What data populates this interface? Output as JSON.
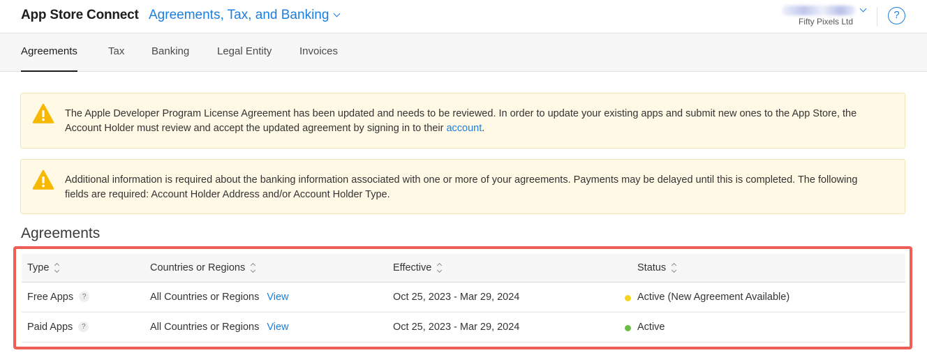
{
  "header": {
    "brand": "App Store Connect",
    "section_menu_label": "Agreements, Tax, and Banking",
    "account_org": "Fifty Pixels Ltd",
    "help_label": "?"
  },
  "tabs": [
    {
      "label": "Agreements",
      "active": true
    },
    {
      "label": "Tax",
      "active": false
    },
    {
      "label": "Banking",
      "active": false
    },
    {
      "label": "Legal Entity",
      "active": false
    },
    {
      "label": "Invoices",
      "active": false
    }
  ],
  "alerts": [
    {
      "icon": "warning-icon",
      "text_before_link": "The Apple Developer Program License Agreement has been updated and needs to be reviewed. In order to update your existing apps and submit new ones to the App Store, the Account Holder must review and accept the updated agreement by signing in to their ",
      "link_text": "account",
      "text_after_link": "."
    },
    {
      "icon": "warning-icon",
      "text": "Additional information is required about the banking information associated with one or more of your agreements. Payments may be delayed until this is completed. The following fields are required: Account Holder Address and/or Account Holder Type."
    }
  ],
  "agreements": {
    "title": "Agreements",
    "columns": [
      "Type",
      "Countries or Regions",
      "Effective",
      "Status"
    ],
    "rows": [
      {
        "type": "Free Apps",
        "help": "?",
        "regions": "All Countries or Regions",
        "view_label": "View",
        "effective": "Oct 25, 2023 - Mar 29, 2024",
        "status": "Active (New Agreement Available)",
        "status_color": "#f5d41f"
      },
      {
        "type": "Paid Apps",
        "help": "?",
        "regions": "All Countries or Regions",
        "view_label": "View",
        "effective": "Oct 25, 2023 - Mar 29, 2024",
        "status": "Active",
        "status_color": "#6cbd45"
      }
    ]
  },
  "colors": {
    "accent": "#1a7fe0",
    "alert_background": "#fff9e5",
    "highlight_border": "#ee5f55",
    "warning_icon": "#f6b800"
  }
}
